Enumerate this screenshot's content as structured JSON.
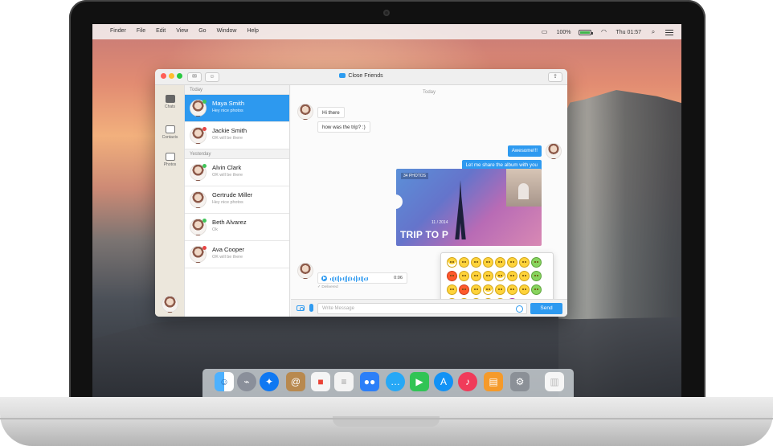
{
  "menubar": {
    "apple": "",
    "items": [
      "Finder",
      "File",
      "Edit",
      "View",
      "Go",
      "Window",
      "Help"
    ],
    "battery": "100%",
    "time": "Thu 01:57"
  },
  "window": {
    "title": "Close Friends",
    "buttons": [
      "✉",
      "☺",
      "⇪"
    ]
  },
  "sidebar": {
    "items": [
      {
        "label": "Chats"
      },
      {
        "label": "Contacts"
      },
      {
        "label": "Photos"
      }
    ]
  },
  "chat_list": {
    "today_label": "Today",
    "yesterday_label": "Yesterday",
    "today": [
      {
        "name": "Maya Smith",
        "preview": "Hey nice photos"
      },
      {
        "name": "Jackie Smith",
        "preview": "OK will be there"
      }
    ],
    "yesterday": [
      {
        "name": "Alvin Clark",
        "preview": "OK will be there"
      },
      {
        "name": "Gertrude Miller",
        "preview": "Hey nice photos"
      },
      {
        "name": "Beth Alvarez",
        "preview": "Ok"
      },
      {
        "name": "Ava Cooper",
        "preview": "OK will be there"
      }
    ]
  },
  "conversation": {
    "date_label": "Today",
    "messages": [
      {
        "text": "Hi there"
      },
      {
        "text": "how was the trip? :)"
      },
      {
        "text": "Awesome!!!"
      },
      {
        "text": "Let me share the album with you"
      }
    ],
    "album": {
      "count_label": "34 PHOTOS",
      "date": "11 / 2014",
      "title": "TRIP TO P"
    },
    "audio": {
      "duration": "0:06",
      "status": "✓ Delivered"
    }
  },
  "composer": {
    "placeholder": "Write Message",
    "send_label": "Send"
  },
  "dock": {
    "items": [
      {
        "name": "finder",
        "color": "#4aa1f7"
      },
      {
        "name": "rocket",
        "color": "#8a8f9a"
      },
      {
        "name": "safari",
        "color": "#0f78f2"
      },
      {
        "name": "contacts",
        "color": "#b8894f"
      },
      {
        "name": "calendar",
        "color": "#f5f5f5"
      },
      {
        "name": "notes",
        "color": "#f3f3f3"
      },
      {
        "name": "people",
        "color": "#2c7ff8"
      },
      {
        "name": "messages",
        "color": "#27a8f6"
      },
      {
        "name": "facetime",
        "color": "#31c455"
      },
      {
        "name": "app-store",
        "color": "#1392f5"
      },
      {
        "name": "music",
        "color": "#f03b5a"
      },
      {
        "name": "ibooks",
        "color": "#f59a2a"
      },
      {
        "name": "settings",
        "color": "#8b9097"
      },
      {
        "name": "trash",
        "color": "#f6f6f6"
      }
    ]
  }
}
